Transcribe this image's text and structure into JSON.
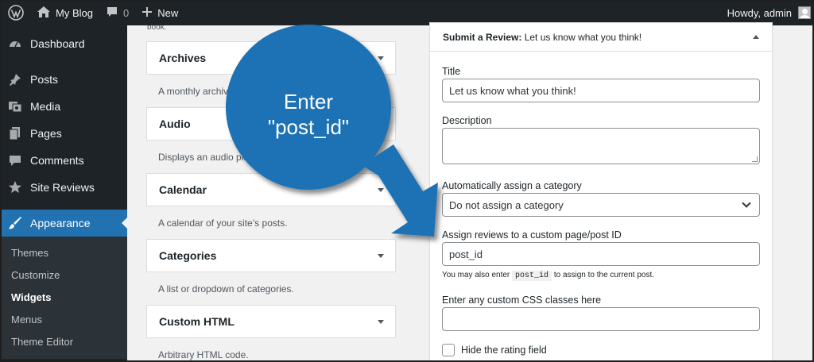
{
  "adminbar": {
    "site_name": "My Blog",
    "comments_count": "0",
    "new_label": "New",
    "greeting": "Howdy, admin"
  },
  "sidebar": {
    "items": [
      {
        "label": "Dashboard",
        "icon": "dashboard-icon"
      },
      {
        "label": "Posts",
        "icon": "pushpin-icon"
      },
      {
        "label": "Media",
        "icon": "media-icon"
      },
      {
        "label": "Pages",
        "icon": "pages-icon"
      },
      {
        "label": "Comments",
        "icon": "comment-icon"
      },
      {
        "label": "Site Reviews",
        "icon": "star-icon"
      },
      {
        "label": "Appearance",
        "icon": "paintbrush-icon"
      }
    ],
    "submenu": [
      {
        "label": "Themes"
      },
      {
        "label": "Customize"
      },
      {
        "label": "Widgets"
      },
      {
        "label": "Menus"
      },
      {
        "label": "Theme Editor"
      }
    ]
  },
  "widgets": {
    "top_fragment": "book.",
    "items": [
      {
        "title": "Archives",
        "desc": "A monthly archive"
      },
      {
        "title": "Audio",
        "desc": "Displays an audio pla"
      },
      {
        "title": "Calendar",
        "desc": "A calendar of your site’s posts."
      },
      {
        "title": "Categories",
        "desc": "A list or dropdown of categories."
      },
      {
        "title": "Custom HTML",
        "desc": "Arbitrary HTML code."
      }
    ]
  },
  "review_widget": {
    "header_bold": "Submit a Review:",
    "header_rest": "Let us know what you think!",
    "title_label": "Title",
    "title_value": "Let us know what you think!",
    "description_label": "Description",
    "category_label": "Automatically assign a category",
    "category_value": "Do not assign a category",
    "assign_label": "Assign reviews to a custom page/post ID",
    "assign_value": "post_id",
    "helper_pre": "You may also enter",
    "helper_code": "post_id",
    "helper_post": "to assign to the current post.",
    "css_label": "Enter any custom CSS classes here",
    "hide_rating_label": "Hide the rating field"
  },
  "callout": {
    "line1": "Enter",
    "line2": "\"post_id\"",
    "color": "#1d72b4"
  },
  "colors": {
    "admin_bar": "#1d2327",
    "active_menu": "#2271b1"
  }
}
